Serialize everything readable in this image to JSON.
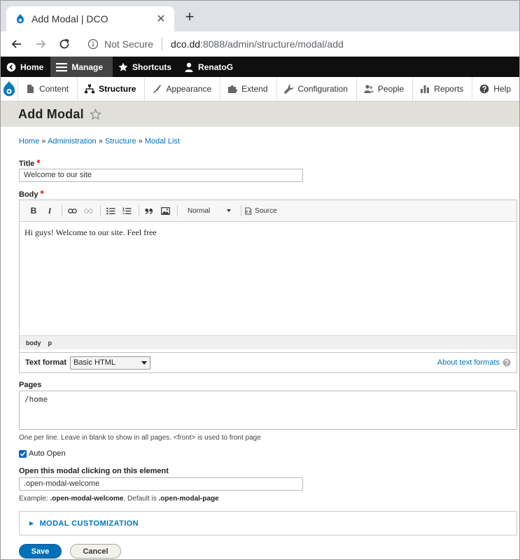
{
  "browser": {
    "tab_title": "Add Modal | DCO",
    "close_glyph": "✕",
    "newtab_glyph": "+",
    "not_secure": "Not Secure",
    "url_host": "dco.dd",
    "url_rest": ":8088/admin/structure/modal/add"
  },
  "toolbar_black": {
    "home": "Home",
    "manage": "Manage",
    "shortcuts": "Shortcuts",
    "user": "RenatoG"
  },
  "toolbar_white": {
    "content": "Content",
    "structure": "Structure",
    "appearance": "Appearance",
    "extend": "Extend",
    "configuration": "Configuration",
    "people": "People",
    "reports": "Reports",
    "help": "Help"
  },
  "page": {
    "title": "Add Modal"
  },
  "breadcrumb": {
    "home": "Home",
    "administration": "Administration",
    "structure": "Structure",
    "modal_list": "Modal List",
    "separator": "»"
  },
  "form": {
    "title_label": "Title",
    "required_mark": "*",
    "title_value": "Welcome to our site",
    "body_label": "Body",
    "editor": {
      "bold": "B",
      "italic": "I",
      "format_select": "Normal",
      "source": "Source",
      "content": "Hi guys! Welcome to our site. Feel free",
      "path_body": "body",
      "path_p": "p"
    },
    "text_format_label": "Text format",
    "text_format_value": "Basic HTML",
    "about_text_formats": "About text formats",
    "pages_label": "Pages",
    "pages_value": "/home",
    "pages_desc": "One per line. Leave in blank to show in all pages. <front> is used to front page",
    "auto_open_label": "Auto Open",
    "element_label": "Open this modal clicking on this element",
    "element_value": ".open-modal-welcome",
    "element_desc_prefix": "Example: ",
    "element_desc_example": ".open-modal-welcome",
    "element_desc_mid": ". Default is ",
    "element_desc_default": ".open-modal-page",
    "customization": "MODAL CUSTOMIZATION",
    "save": "Save",
    "cancel": "Cancel"
  },
  "colors": {
    "link": "#0074bd",
    "primary_button": "#0071b8",
    "header_bg": "#e0e0d8",
    "toolbar_black": "#0f0f0f",
    "required": "#e00000"
  }
}
